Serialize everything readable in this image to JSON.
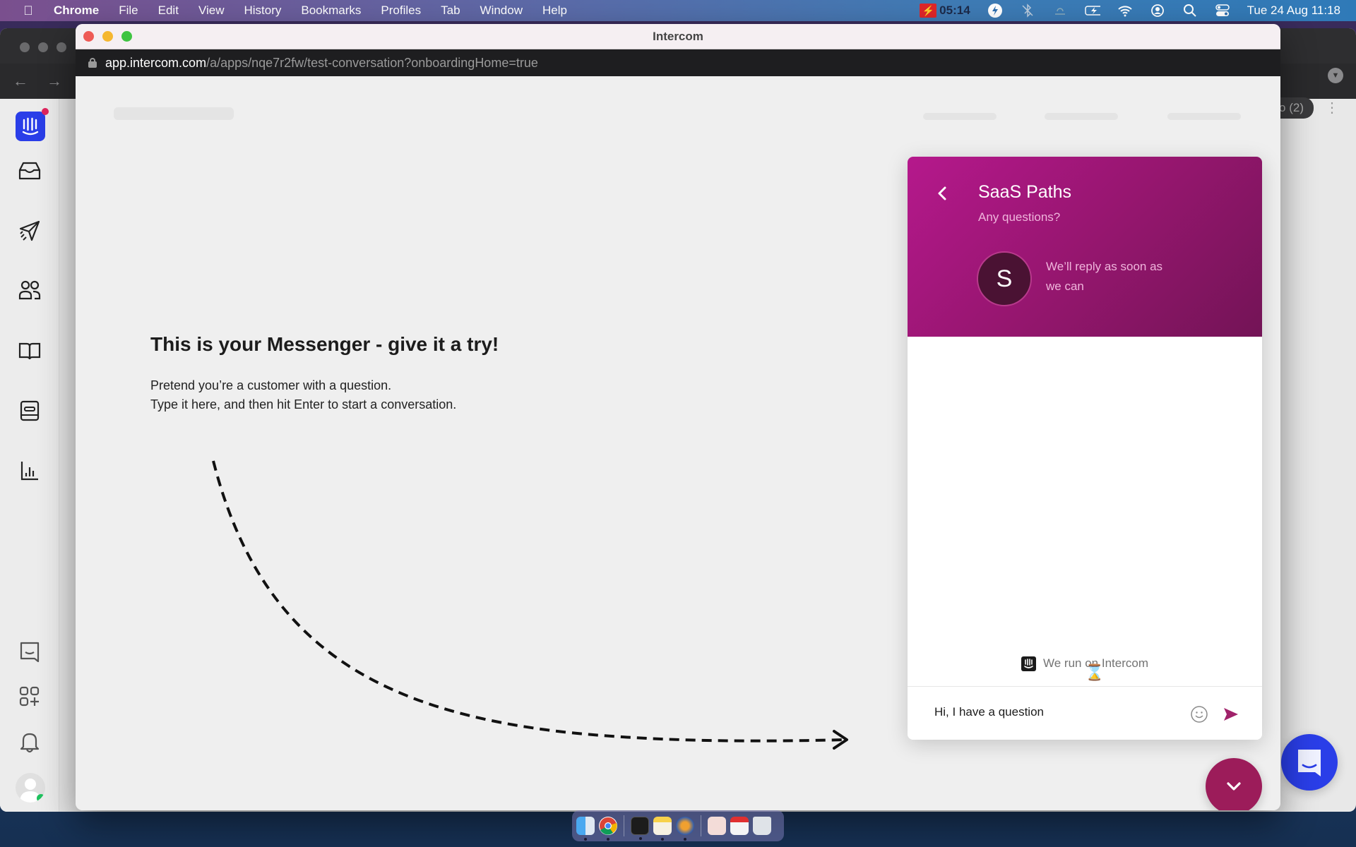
{
  "menubar": {
    "app_name": "Chrome",
    "items": [
      "File",
      "Edit",
      "View",
      "History",
      "Bookmarks",
      "Profiles",
      "Tab",
      "Window",
      "Help"
    ],
    "recording_timer": "05:14",
    "datetime": "Tue 24 Aug  11:18",
    "status_icons": [
      "recording-icon",
      "flash-icon",
      "bluetooth-icon",
      "brightness-icon",
      "battery-charging-icon",
      "wifi-icon",
      "user-icon",
      "search-icon",
      "control-center-icon"
    ]
  },
  "background_window": {
    "tab_tail": "o (2)"
  },
  "window": {
    "title": "Intercom",
    "url_host": "app.intercom.com",
    "url_path": "/a/apps/nqe7r2fw/test-conversation?onboardingHome=true"
  },
  "app_nav": {
    "items": [
      "inbox-icon",
      "outbound-icon",
      "contacts-icon",
      "articles-icon",
      "messenger-icon",
      "reports-icon"
    ],
    "bottom_items": [
      "messenger-chat-icon",
      "app-store-icon",
      "notifications-icon"
    ],
    "brand_color": "#2a3ee8"
  },
  "hero": {
    "title": "This is your Messenger - give it a try!",
    "line1": "Pretend you’re a customer with a question.",
    "line2": "Type it here, and then hit Enter to start a conversation."
  },
  "messenger": {
    "team_name": "SaaS Paths",
    "subtitle": "Any questions?",
    "avatar_initial": "S",
    "reply_time": "We’ll reply as soon as we can",
    "powered_by": "We run on Intercom",
    "input_value": "Hi, I have a question",
    "header_color": "#9e1678",
    "send_color": "#a0226a"
  },
  "launchers": {
    "close_color": "#9c1c5a",
    "main_color": "#2a3ee8"
  },
  "dock": {
    "apps": [
      "finder",
      "chrome",
      "terminal",
      "notes",
      "reeder",
      "preview-doc",
      "screenshot",
      "trash"
    ]
  }
}
